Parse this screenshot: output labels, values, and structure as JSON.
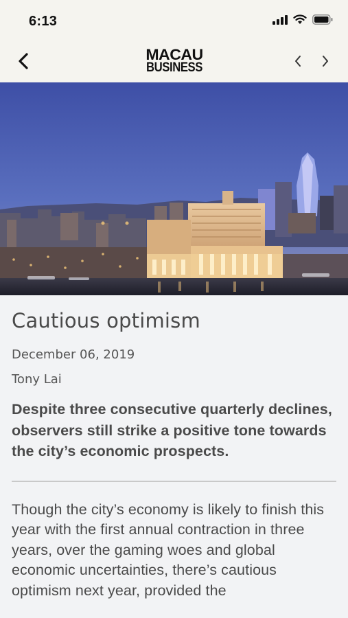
{
  "status": {
    "time": "6:13"
  },
  "nav": {
    "logo_line1": "MACAU",
    "logo_line2": "BUSINESS"
  },
  "article": {
    "title": "Cautious optimism",
    "date": "December 06, 2019",
    "author": "Tony Lai",
    "lead": "Despite three consecutive quarterly declines, observers still strike a positive tone towards the city’s economic prospects.",
    "body": "Though the city’s economy is likely to finish this year with the first annual contraction in three years, over the gaming woes and global economic uncertainties, there’s cautious optimism next year, provided the"
  },
  "icons": {
    "back": "chevron-left-icon",
    "prev": "chevron-left-icon",
    "next": "chevron-right-icon",
    "signal": "cellular-signal-icon",
    "wifi": "wifi-icon",
    "battery": "battery-icon"
  },
  "colors": {
    "header_bg": "#f5f4ef",
    "page_bg": "#f2f3f5",
    "text": "#4a4a4a"
  }
}
